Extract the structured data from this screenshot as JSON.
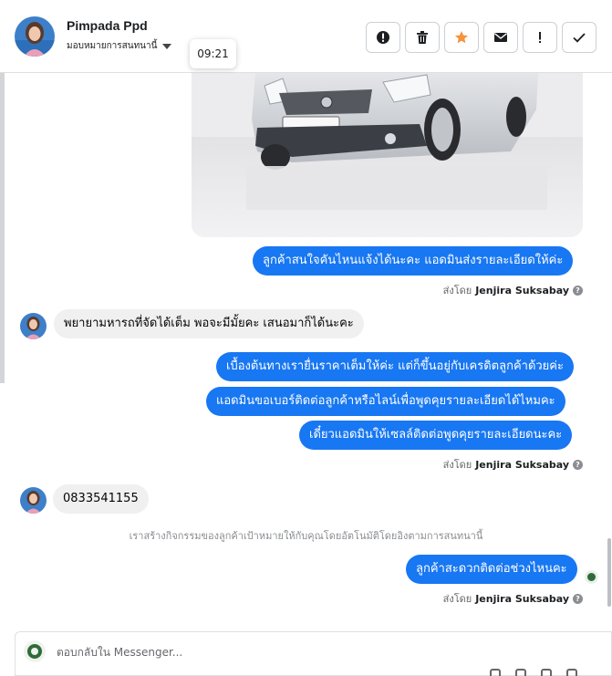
{
  "header": {
    "name": "Pimpada Ppd",
    "assign_label": "มอบหมายการสนทนานี้",
    "tooltip_time": "09:21",
    "actions": [
      {
        "icon": "alert-circle-icon",
        "name": "mark-spam-button"
      },
      {
        "icon": "trash-icon",
        "name": "delete-button"
      },
      {
        "icon": "star-icon",
        "name": "star-button"
      },
      {
        "icon": "envelope-icon",
        "name": "mark-unread-button"
      },
      {
        "icon": "exclamation-icon",
        "name": "follow-up-button"
      },
      {
        "icon": "check-icon",
        "name": "mark-done-button"
      }
    ]
  },
  "messages": {
    "out_1": "ลูกค้าสนใจคันไหนแจ้งได้นะคะ แอดมินส่งรายละเอียดให้ค่ะ",
    "sent_by_prefix": "ส่งโดย",
    "sent_by_name": "Jenjira Suksabay",
    "in_1": "พยายามหารถที่จัดได้เต็ม พอจะมีมั้ยคะ เสนอมาก็ได้นะคะ",
    "out_2": "เบื้องต้นทางเรายื่นราคาเต็มให้ค่ะ แต่ก็ขึ้นอยู่กับเครดิตลูกค้าด้วยค่ะ",
    "out_3": "แอดมินขอเบอร์ติดต่อลูกค้าหรือไลน์เพื่อพูดคุยรายละเอียดได้ไหมคะ",
    "out_4": "เดี๋ยวแอดมินให้เซลล์ติดต่อพูดคุยรายละเอียดนะคะ",
    "in_2": "0833541155",
    "system_note": "เราสร้างกิจกรรมของลูกค้าเป้าหมายให้กับคุณโดยอัตโนมัติโดยอิงตามการสนทนานี้",
    "out_5": "ลูกค้าสะดวกติดต่อช่วงไหนคะ"
  },
  "composer": {
    "placeholder": "ตอบกลับใน Messenger..."
  },
  "colors": {
    "outgoing_bubble": "#1877f2",
    "incoming_bubble": "#f0f0f0",
    "star_orange": "#f7923a"
  }
}
